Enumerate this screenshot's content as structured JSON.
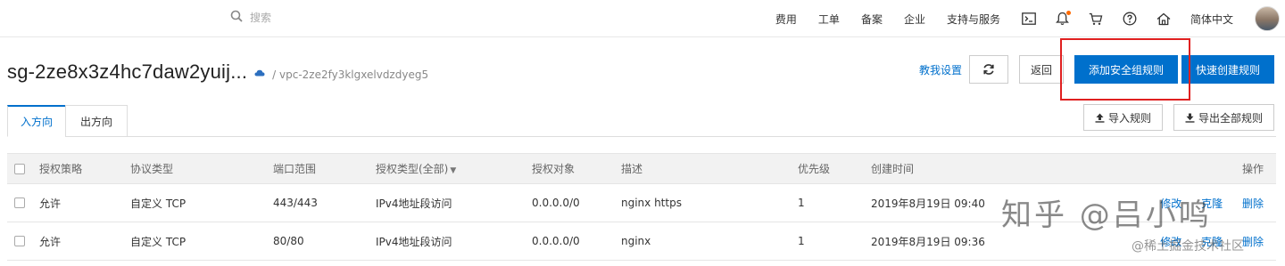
{
  "topnav": {
    "search": {
      "placeholder": "搜索"
    },
    "links": [
      "费用",
      "工单",
      "备案",
      "企业",
      "支持与服务"
    ],
    "language": "简体中文",
    "icons": [
      "terminal-icon",
      "bell-icon",
      "cart-icon",
      "help-icon",
      "home-icon"
    ]
  },
  "header": {
    "title": "sg-2ze8x3z4hc7daw2yuij...",
    "breadcrumb": "/ vpc-2ze2fy3klgxelvdzdyeg5"
  },
  "actions": {
    "tutorial": "教我设置",
    "back": "返回",
    "add_rule": "添加安全组规则",
    "quick_create": "快速创建规则"
  },
  "tabs": {
    "inbound": "入方向",
    "outbound": "出方向"
  },
  "tools": {
    "import": "导入规则",
    "export": "导出全部规则"
  },
  "table": {
    "headers": {
      "policy": "授权策略",
      "protocol": "协议类型",
      "port": "端口范围",
      "auth_type": "授权类型(全部)",
      "object": "授权对象",
      "desc": "描述",
      "priority": "优先级",
      "created": "创建时间",
      "ops": "操作"
    },
    "rows": [
      {
        "policy": "允许",
        "protocol": "自定义 TCP",
        "port": "443/443",
        "auth_type": "IPv4地址段访问",
        "object": "0.0.0.0/0",
        "desc": "nginx https",
        "priority": "1",
        "created": "2019年8月19日 09:40",
        "op_edit": "修改",
        "op_clone": "克隆",
        "op_delete": "删除"
      },
      {
        "policy": "允许",
        "protocol": "自定义 TCP",
        "port": "80/80",
        "auth_type": "IPv4地址段访问",
        "object": "0.0.0.0/0",
        "desc": "nginx",
        "priority": "1",
        "created": "2019年8月19日 09:36",
        "op_edit": "修改",
        "op_clone": "克隆",
        "op_delete": "删除"
      }
    ]
  },
  "watermark": {
    "main": "知乎 @吕小鸣",
    "sub": "@稀土掘金技术社区"
  },
  "colors": {
    "accent": "#0070cc",
    "highlight": "#e02020"
  }
}
